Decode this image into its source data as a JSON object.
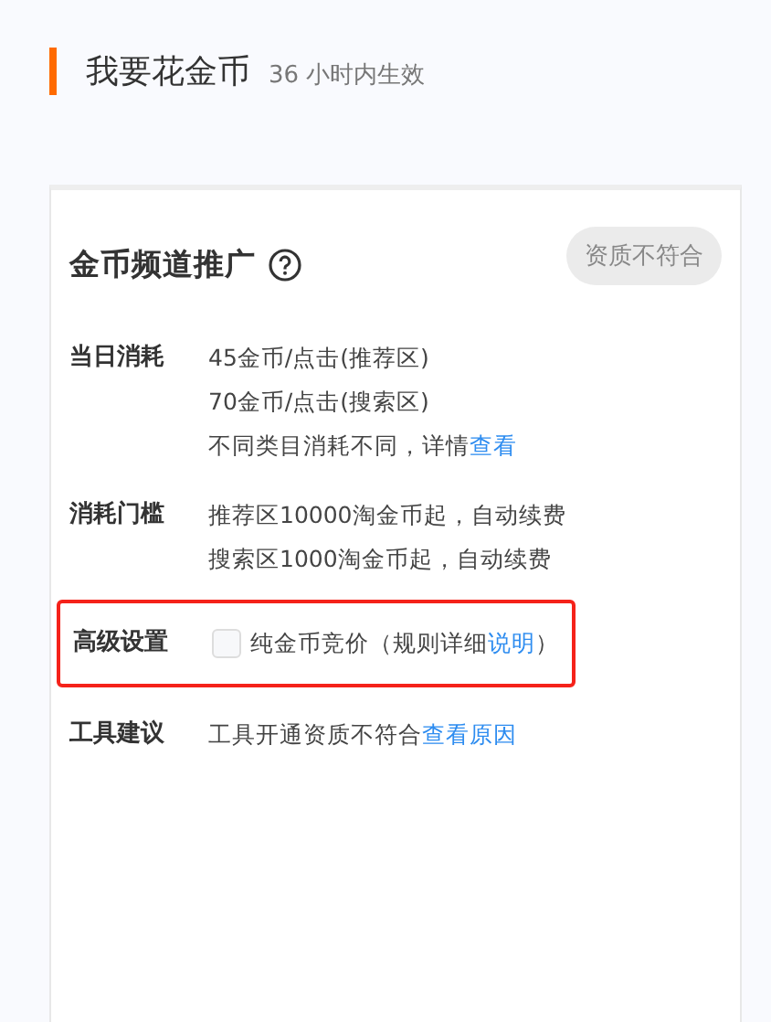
{
  "header": {
    "title": "我要花金币",
    "subtitle": "36 小时内生效"
  },
  "card": {
    "title": "金币频道推广",
    "badge": "资质不符合",
    "rows": [
      {
        "kind": "text",
        "label": "当日消耗",
        "highlighted": false,
        "lines": [
          {
            "text": "45金币/点击(推荐区)"
          },
          {
            "text": "70金币/点击(搜索区)"
          },
          {
            "text": "不同类目消耗不同，详情",
            "link": "查看"
          }
        ]
      },
      {
        "kind": "text",
        "label": "消耗门槛",
        "highlighted": false,
        "lines": [
          {
            "text": "推荐区10000淘金币起，自动续费"
          },
          {
            "text": "搜索区1000淘金币起，自动续费"
          }
        ]
      },
      {
        "kind": "checkbox",
        "label": "高级设置",
        "highlighted": true,
        "checked": false,
        "text": "纯金币竞价（规则详细",
        "link": "说明",
        "suffix": "）"
      },
      {
        "kind": "text",
        "label": "工具建议",
        "highlighted": false,
        "lines": [
          {
            "text": "工具开通资质不符合",
            "link": "查看原因"
          }
        ]
      }
    ]
  }
}
